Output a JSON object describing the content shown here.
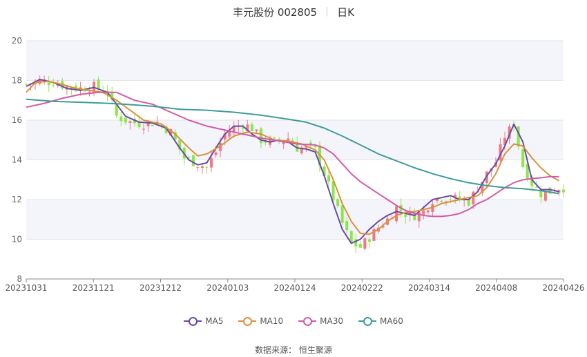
{
  "header": {
    "stock_name_code": "丰元股份 002805",
    "period": "日K"
  },
  "legend": [
    {
      "label": "MA5",
      "color": "#6a4aa8"
    },
    {
      "label": "MA10",
      "color": "#d9913a"
    },
    {
      "label": "MA30",
      "color": "#d45aa6"
    },
    {
      "label": "MA60",
      "color": "#3f9a9a"
    }
  ],
  "source_label": "数据来源：",
  "source_name": "恒生聚源",
  "colors": {
    "up": "#f07a82",
    "down": "#8de64a",
    "grid": "#e4e4e4",
    "band": "#f3f5fa"
  },
  "chart_data": {
    "type": "candlestick",
    "ylim": [
      8,
      20
    ],
    "yticks": [
      8,
      10,
      12,
      14,
      16,
      18,
      20
    ],
    "grid": true,
    "legend_position": "bottom",
    "xtick_labels": [
      "20231031",
      "20231121",
      "20231212",
      "20240103",
      "20240124",
      "20240222",
      "20240314",
      "20240408",
      "20240426"
    ],
    "close_anchors": [
      [
        0,
        17.8
      ],
      [
        3,
        18.0
      ],
      [
        6,
        17.9
      ],
      [
        9,
        17.7
      ],
      [
        12,
        17.6
      ],
      [
        15,
        17.7
      ],
      [
        18,
        17.4
      ],
      [
        20,
        16.2
      ],
      [
        23,
        15.9
      ],
      [
        26,
        15.8
      ],
      [
        29,
        15.9
      ],
      [
        32,
        15.4
      ],
      [
        35,
        14.1
      ],
      [
        38,
        13.8
      ],
      [
        40,
        13.6
      ],
      [
        42,
        14.4
      ],
      [
        44,
        15.3
      ],
      [
        46,
        15.6
      ],
      [
        48,
        15.8
      ],
      [
        50,
        15.6
      ],
      [
        52,
        15.0
      ],
      [
        55,
        14.9
      ],
      [
        58,
        15.1
      ],
      [
        60,
        14.6
      ],
      [
        62,
        14.6
      ],
      [
        64,
        14.5
      ],
      [
        66,
        13.3
      ],
      [
        68,
        12.1
      ],
      [
        70,
        10.8
      ],
      [
        72,
        9.8
      ],
      [
        74,
        9.6
      ],
      [
        76,
        10.1
      ],
      [
        78,
        10.6
      ],
      [
        80,
        11.0
      ],
      [
        82,
        11.6
      ],
      [
        84,
        11.3
      ],
      [
        86,
        11.2
      ],
      [
        88,
        11.4
      ],
      [
        90,
        12.0
      ],
      [
        92,
        12.1
      ],
      [
        94,
        12.1
      ],
      [
        96,
        12.0
      ],
      [
        98,
        11.9
      ],
      [
        100,
        12.6
      ],
      [
        102,
        13.3
      ],
      [
        104,
        13.9
      ],
      [
        106,
        15.2
      ],
      [
        108,
        15.8
      ],
      [
        110,
        13.7
      ],
      [
        112,
        12.8
      ],
      [
        114,
        12.3
      ],
      [
        116,
        12.4
      ],
      [
        118,
        12.6
      ]
    ],
    "ma_series": [
      {
        "name": "MA5",
        "points": [
          [
            0,
            17.7
          ],
          [
            3,
            18.05
          ],
          [
            6,
            17.9
          ],
          [
            9,
            17.6
          ],
          [
            12,
            17.5
          ],
          [
            15,
            17.65
          ],
          [
            18,
            17.4
          ],
          [
            20,
            16.8
          ],
          [
            22,
            16.2
          ],
          [
            25,
            15.9
          ],
          [
            28,
            15.85
          ],
          [
            31,
            15.6
          ],
          [
            34,
            14.6
          ],
          [
            36,
            14.0
          ],
          [
            38,
            13.75
          ],
          [
            40,
            13.85
          ],
          [
            42,
            14.6
          ],
          [
            44,
            15.3
          ],
          [
            46,
            15.7
          ],
          [
            48,
            15.7
          ],
          [
            50,
            15.3
          ],
          [
            52,
            15.0
          ],
          [
            54,
            14.9
          ],
          [
            56,
            15.0
          ],
          [
            58,
            14.9
          ],
          [
            60,
            14.6
          ],
          [
            62,
            14.55
          ],
          [
            64,
            14.4
          ],
          [
            66,
            13.2
          ],
          [
            68,
            11.8
          ],
          [
            70,
            10.5
          ],
          [
            72,
            9.8
          ],
          [
            74,
            10.0
          ],
          [
            76,
            10.5
          ],
          [
            78,
            10.9
          ],
          [
            80,
            11.2
          ],
          [
            82,
            11.4
          ],
          [
            84,
            11.3
          ],
          [
            86,
            11.2
          ],
          [
            88,
            11.6
          ],
          [
            90,
            12.0
          ],
          [
            92,
            12.1
          ],
          [
            94,
            12.2
          ],
          [
            96,
            12.0
          ],
          [
            98,
            12.0
          ],
          [
            100,
            12.4
          ],
          [
            102,
            13.2
          ],
          [
            104,
            13.8
          ],
          [
            106,
            14.7
          ],
          [
            108,
            15.8
          ],
          [
            110,
            14.9
          ],
          [
            112,
            13.0
          ],
          [
            114,
            12.5
          ],
          [
            116,
            12.5
          ],
          [
            118,
            12.4
          ]
        ]
      },
      {
        "name": "MA10",
        "points": [
          [
            0,
            17.4
          ],
          [
            2,
            17.9
          ],
          [
            5,
            17.95
          ],
          [
            8,
            17.8
          ],
          [
            11,
            17.6
          ],
          [
            14,
            17.5
          ],
          [
            17,
            17.4
          ],
          [
            20,
            17.0
          ],
          [
            23,
            16.5
          ],
          [
            26,
            16.0
          ],
          [
            30,
            15.8
          ],
          [
            33,
            15.3
          ],
          [
            36,
            14.6
          ],
          [
            38,
            14.2
          ],
          [
            40,
            14.3
          ],
          [
            43,
            14.7
          ],
          [
            46,
            15.2
          ],
          [
            49,
            15.4
          ],
          [
            52,
            15.3
          ],
          [
            55,
            15.0
          ],
          [
            58,
            14.95
          ],
          [
            61,
            14.8
          ],
          [
            64,
            14.5
          ],
          [
            66,
            14.0
          ],
          [
            68,
            13.0
          ],
          [
            70,
            11.8
          ],
          [
            72,
            10.9
          ],
          [
            74,
            10.3
          ],
          [
            76,
            10.25
          ],
          [
            78,
            10.5
          ],
          [
            80,
            10.9
          ],
          [
            82,
            11.2
          ],
          [
            84,
            11.35
          ],
          [
            86,
            11.4
          ],
          [
            88,
            11.5
          ],
          [
            90,
            11.6
          ],
          [
            92,
            11.8
          ],
          [
            94,
            11.9
          ],
          [
            96,
            12.0
          ],
          [
            98,
            12.1
          ],
          [
            100,
            12.2
          ],
          [
            102,
            12.6
          ],
          [
            104,
            13.3
          ],
          [
            106,
            14.3
          ],
          [
            108,
            14.8
          ],
          [
            110,
            14.7
          ],
          [
            112,
            14.1
          ],
          [
            114,
            13.6
          ],
          [
            116,
            13.2
          ],
          [
            118,
            12.95
          ]
        ]
      },
      {
        "name": "MA30",
        "points": [
          [
            0,
            16.65
          ],
          [
            4,
            16.85
          ],
          [
            8,
            17.1
          ],
          [
            12,
            17.3
          ],
          [
            16,
            17.4
          ],
          [
            20,
            17.4
          ],
          [
            24,
            17.0
          ],
          [
            28,
            16.8
          ],
          [
            32,
            16.4
          ],
          [
            36,
            16.0
          ],
          [
            40,
            15.7
          ],
          [
            44,
            15.5
          ],
          [
            48,
            15.3
          ],
          [
            52,
            15.1
          ],
          [
            56,
            14.95
          ],
          [
            60,
            14.8
          ],
          [
            64,
            14.75
          ],
          [
            66,
            14.6
          ],
          [
            68,
            14.3
          ],
          [
            70,
            13.8
          ],
          [
            72,
            13.3
          ],
          [
            74,
            12.9
          ],
          [
            76,
            12.6
          ],
          [
            78,
            12.3
          ],
          [
            80,
            12.0
          ],
          [
            82,
            11.7
          ],
          [
            84,
            11.45
          ],
          [
            86,
            11.3
          ],
          [
            88,
            11.2
          ],
          [
            90,
            11.15
          ],
          [
            92,
            11.15
          ],
          [
            94,
            11.2
          ],
          [
            96,
            11.3
          ],
          [
            98,
            11.5
          ],
          [
            100,
            11.8
          ],
          [
            102,
            12.0
          ],
          [
            104,
            12.3
          ],
          [
            106,
            12.6
          ],
          [
            108,
            12.85
          ],
          [
            110,
            13.0
          ],
          [
            112,
            13.05
          ],
          [
            114,
            13.1
          ],
          [
            116,
            13.15
          ],
          [
            118,
            13.15
          ]
        ]
      },
      {
        "name": "MA60",
        "points": [
          [
            0,
            17.05
          ],
          [
            6,
            16.95
          ],
          [
            12,
            16.9
          ],
          [
            18,
            16.85
          ],
          [
            22,
            16.8
          ],
          [
            28,
            16.7
          ],
          [
            34,
            16.55
          ],
          [
            40,
            16.5
          ],
          [
            46,
            16.4
          ],
          [
            52,
            16.25
          ],
          [
            58,
            16.05
          ],
          [
            62,
            15.9
          ],
          [
            66,
            15.6
          ],
          [
            70,
            15.2
          ],
          [
            74,
            14.75
          ],
          [
            78,
            14.3
          ],
          [
            82,
            13.95
          ],
          [
            86,
            13.6
          ],
          [
            90,
            13.3
          ],
          [
            94,
            13.05
          ],
          [
            98,
            12.85
          ],
          [
            102,
            12.7
          ],
          [
            106,
            12.6
          ],
          [
            110,
            12.55
          ],
          [
            114,
            12.45
          ],
          [
            118,
            12.3
          ]
        ]
      }
    ]
  }
}
